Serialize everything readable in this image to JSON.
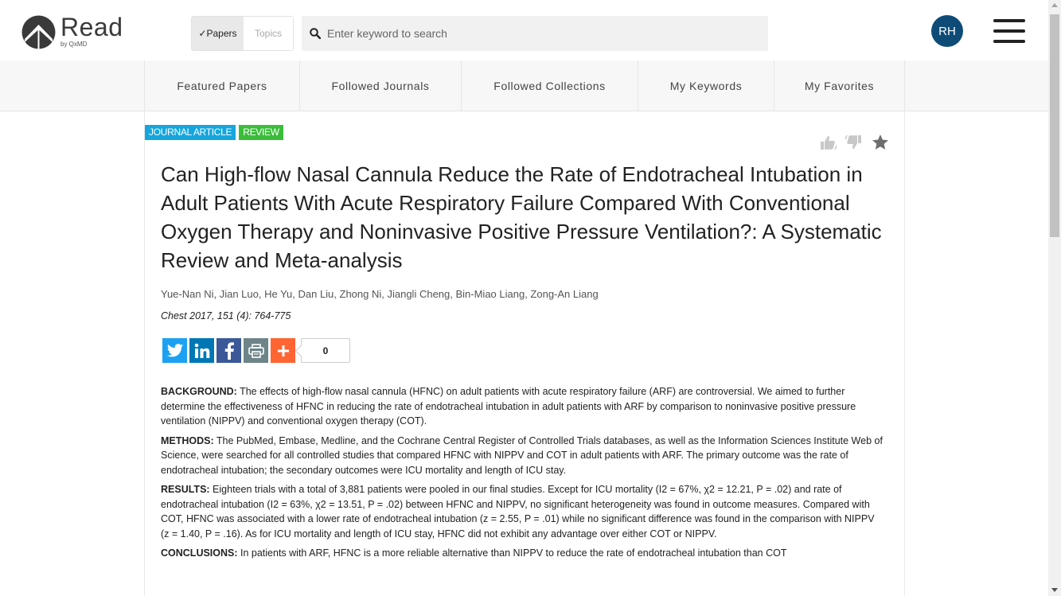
{
  "brand": {
    "name": "Read",
    "sub": "by QxMD"
  },
  "toggle": {
    "papers": "✓Papers",
    "topics": "Topics"
  },
  "search": {
    "placeholder": "Enter keyword to search"
  },
  "user": {
    "initials": "RH"
  },
  "nav": {
    "items": [
      "Featured Papers",
      "Followed Journals",
      "Followed Collections",
      "My Keywords",
      "My Favorites"
    ]
  },
  "article": {
    "tags": [
      "JOURNAL ARTICLE",
      "REVIEW"
    ],
    "title": "Can High-flow Nasal Cannula Reduce the Rate of Endotracheal Intubation in Adult Patients With Acute Respiratory Failure Compared With Conventional Oxygen Therapy and Noninvasive Positive Pressure Ventilation?: A Systematic Review and Meta-analysis",
    "authors": "Yue-Nan Ni, Jian Luo, He Yu, Dan Liu, Zhong Ni, Jiangli Cheng, Bin-Miao Liang, Zong-An Liang",
    "citation": "Chest 2017, 151 (4): 764-775",
    "share_count": "0",
    "abstract": [
      {
        "label": "BACKGROUND:",
        "text": " The effects of high-flow nasal cannula (HFNC) on adult patients with acute respiratory failure (ARF) are controversial. We aimed to further determine the effectiveness of HFNC in reducing the rate of endotracheal intubation in adult patients with ARF by comparison to noninvasive positive pressure ventilation (NIPPV) and conventional oxygen therapy (COT)."
      },
      {
        "label": "METHODS:",
        "text": " The PubMed, Embase, Medline, and the Cochrane Central Register of Controlled Trials databases, as well as the Information Sciences Institute Web of Science, were searched for all controlled studies that compared HFNC with NIPPV and COT in adult patients with ARF. The primary outcome was the rate of endotracheal intubation; the secondary outcomes were ICU mortality and length of ICU stay."
      },
      {
        "label": "RESULTS:",
        "text": " Eighteen trials with a total of 3,881 patients were pooled in our final studies. Except for ICU mortality (I2  = 67%, χ2  = 12.21, P = .02) and rate of endotracheal intubation (I2  = 63%, χ2  = 13.51, P = .02) between HFNC and NIPPV, no significant heterogeneity was found in outcome measures. Compared with COT, HFNC was associated with a lower rate of endotracheal intubation (z = 2.55, P = .01) while no significant difference was found in the comparison with NIPPV (z = 1.40, P = .16). As for ICU mortality and length of ICU stay, HFNC did not exhibit any advantage over either COT or NIPPV."
      },
      {
        "label": "CONCLUSIONS:",
        "text": " In patients with ARF, HFNC is a more reliable alternative than NIPPV to reduce the rate of endotracheal intubation than COT"
      }
    ]
  },
  "icons": [
    "logo-icon",
    "search-icon",
    "thumbs-up-icon",
    "thumbs-down-icon",
    "star-icon",
    "twitter-icon",
    "linkedin-icon",
    "facebook-icon",
    "print-icon",
    "plus-icon"
  ]
}
